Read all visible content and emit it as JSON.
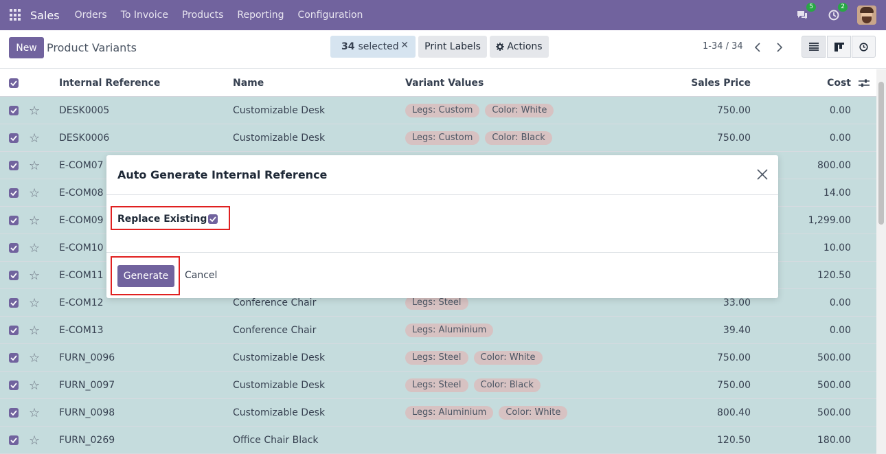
{
  "navbar": {
    "app_name": "Sales",
    "menu": [
      "Orders",
      "To Invoice",
      "Products",
      "Reporting",
      "Configuration"
    ],
    "messages_badge": "5",
    "activities_badge": "2",
    "bg_color": "#71639e"
  },
  "control_panel": {
    "new_label": "New",
    "title": "Product Variants",
    "selected_count": "34",
    "selected_label": "selected",
    "print_labels": "Print Labels",
    "actions": "Actions",
    "pager": "1-34 / 34"
  },
  "list": {
    "columns": {
      "internal_reference": "Internal Reference",
      "name": "Name",
      "variant_values": "Variant Values",
      "sales_price": "Sales Price",
      "cost": "Cost"
    },
    "rows": [
      {
        "ref": "DESK0005",
        "name": "Customizable Desk",
        "tags": [
          "Legs: Custom",
          "Color: White"
        ],
        "price": "750.00",
        "cost": "0.00"
      },
      {
        "ref": "DESK0006",
        "name": "Customizable Desk",
        "tags": [
          "Legs: Custom",
          "Color: Black"
        ],
        "price": "750.00",
        "cost": "0.00"
      },
      {
        "ref": "E-COM07",
        "name": "",
        "tags": [],
        "price": "",
        "cost": "800.00"
      },
      {
        "ref": "E-COM08",
        "name": "",
        "tags": [],
        "price": "",
        "cost": "14.00"
      },
      {
        "ref": "E-COM09",
        "name": "",
        "tags": [],
        "price": "",
        "cost": "1,299.00"
      },
      {
        "ref": "E-COM10",
        "name": "",
        "tags": [],
        "price": "",
        "cost": "10.00"
      },
      {
        "ref": "E-COM11",
        "name": "",
        "tags": [],
        "price": "",
        "cost": "120.50"
      },
      {
        "ref": "E-COM12",
        "name": "Conference Chair",
        "tags": [
          "Legs: Steel"
        ],
        "price": "33.00",
        "cost": "0.00"
      },
      {
        "ref": "E-COM13",
        "name": "Conference Chair",
        "tags": [
          "Legs: Aluminium"
        ],
        "price": "39.40",
        "cost": "0.00"
      },
      {
        "ref": "FURN_0096",
        "name": "Customizable Desk",
        "tags": [
          "Legs: Steel",
          "Color: White"
        ],
        "price": "750.00",
        "cost": "500.00"
      },
      {
        "ref": "FURN_0097",
        "name": "Customizable Desk",
        "tags": [
          "Legs: Steel",
          "Color: Black"
        ],
        "price": "750.00",
        "cost": "500.00"
      },
      {
        "ref": "FURN_0098",
        "name": "Customizable Desk",
        "tags": [
          "Legs: Aluminium",
          "Color: White"
        ],
        "price": "800.40",
        "cost": "500.00"
      },
      {
        "ref": "FURN_0269",
        "name": "Office Chair Black",
        "tags": [],
        "price": "120.50",
        "cost": "180.00"
      }
    ]
  },
  "dialog": {
    "title": "Auto Generate Internal Reference",
    "replace_existing_label": "Replace Existing ?",
    "replace_existing_checked": true,
    "generate_label": "Generate",
    "cancel_label": "Cancel",
    "highlight_color": "#e02020"
  }
}
